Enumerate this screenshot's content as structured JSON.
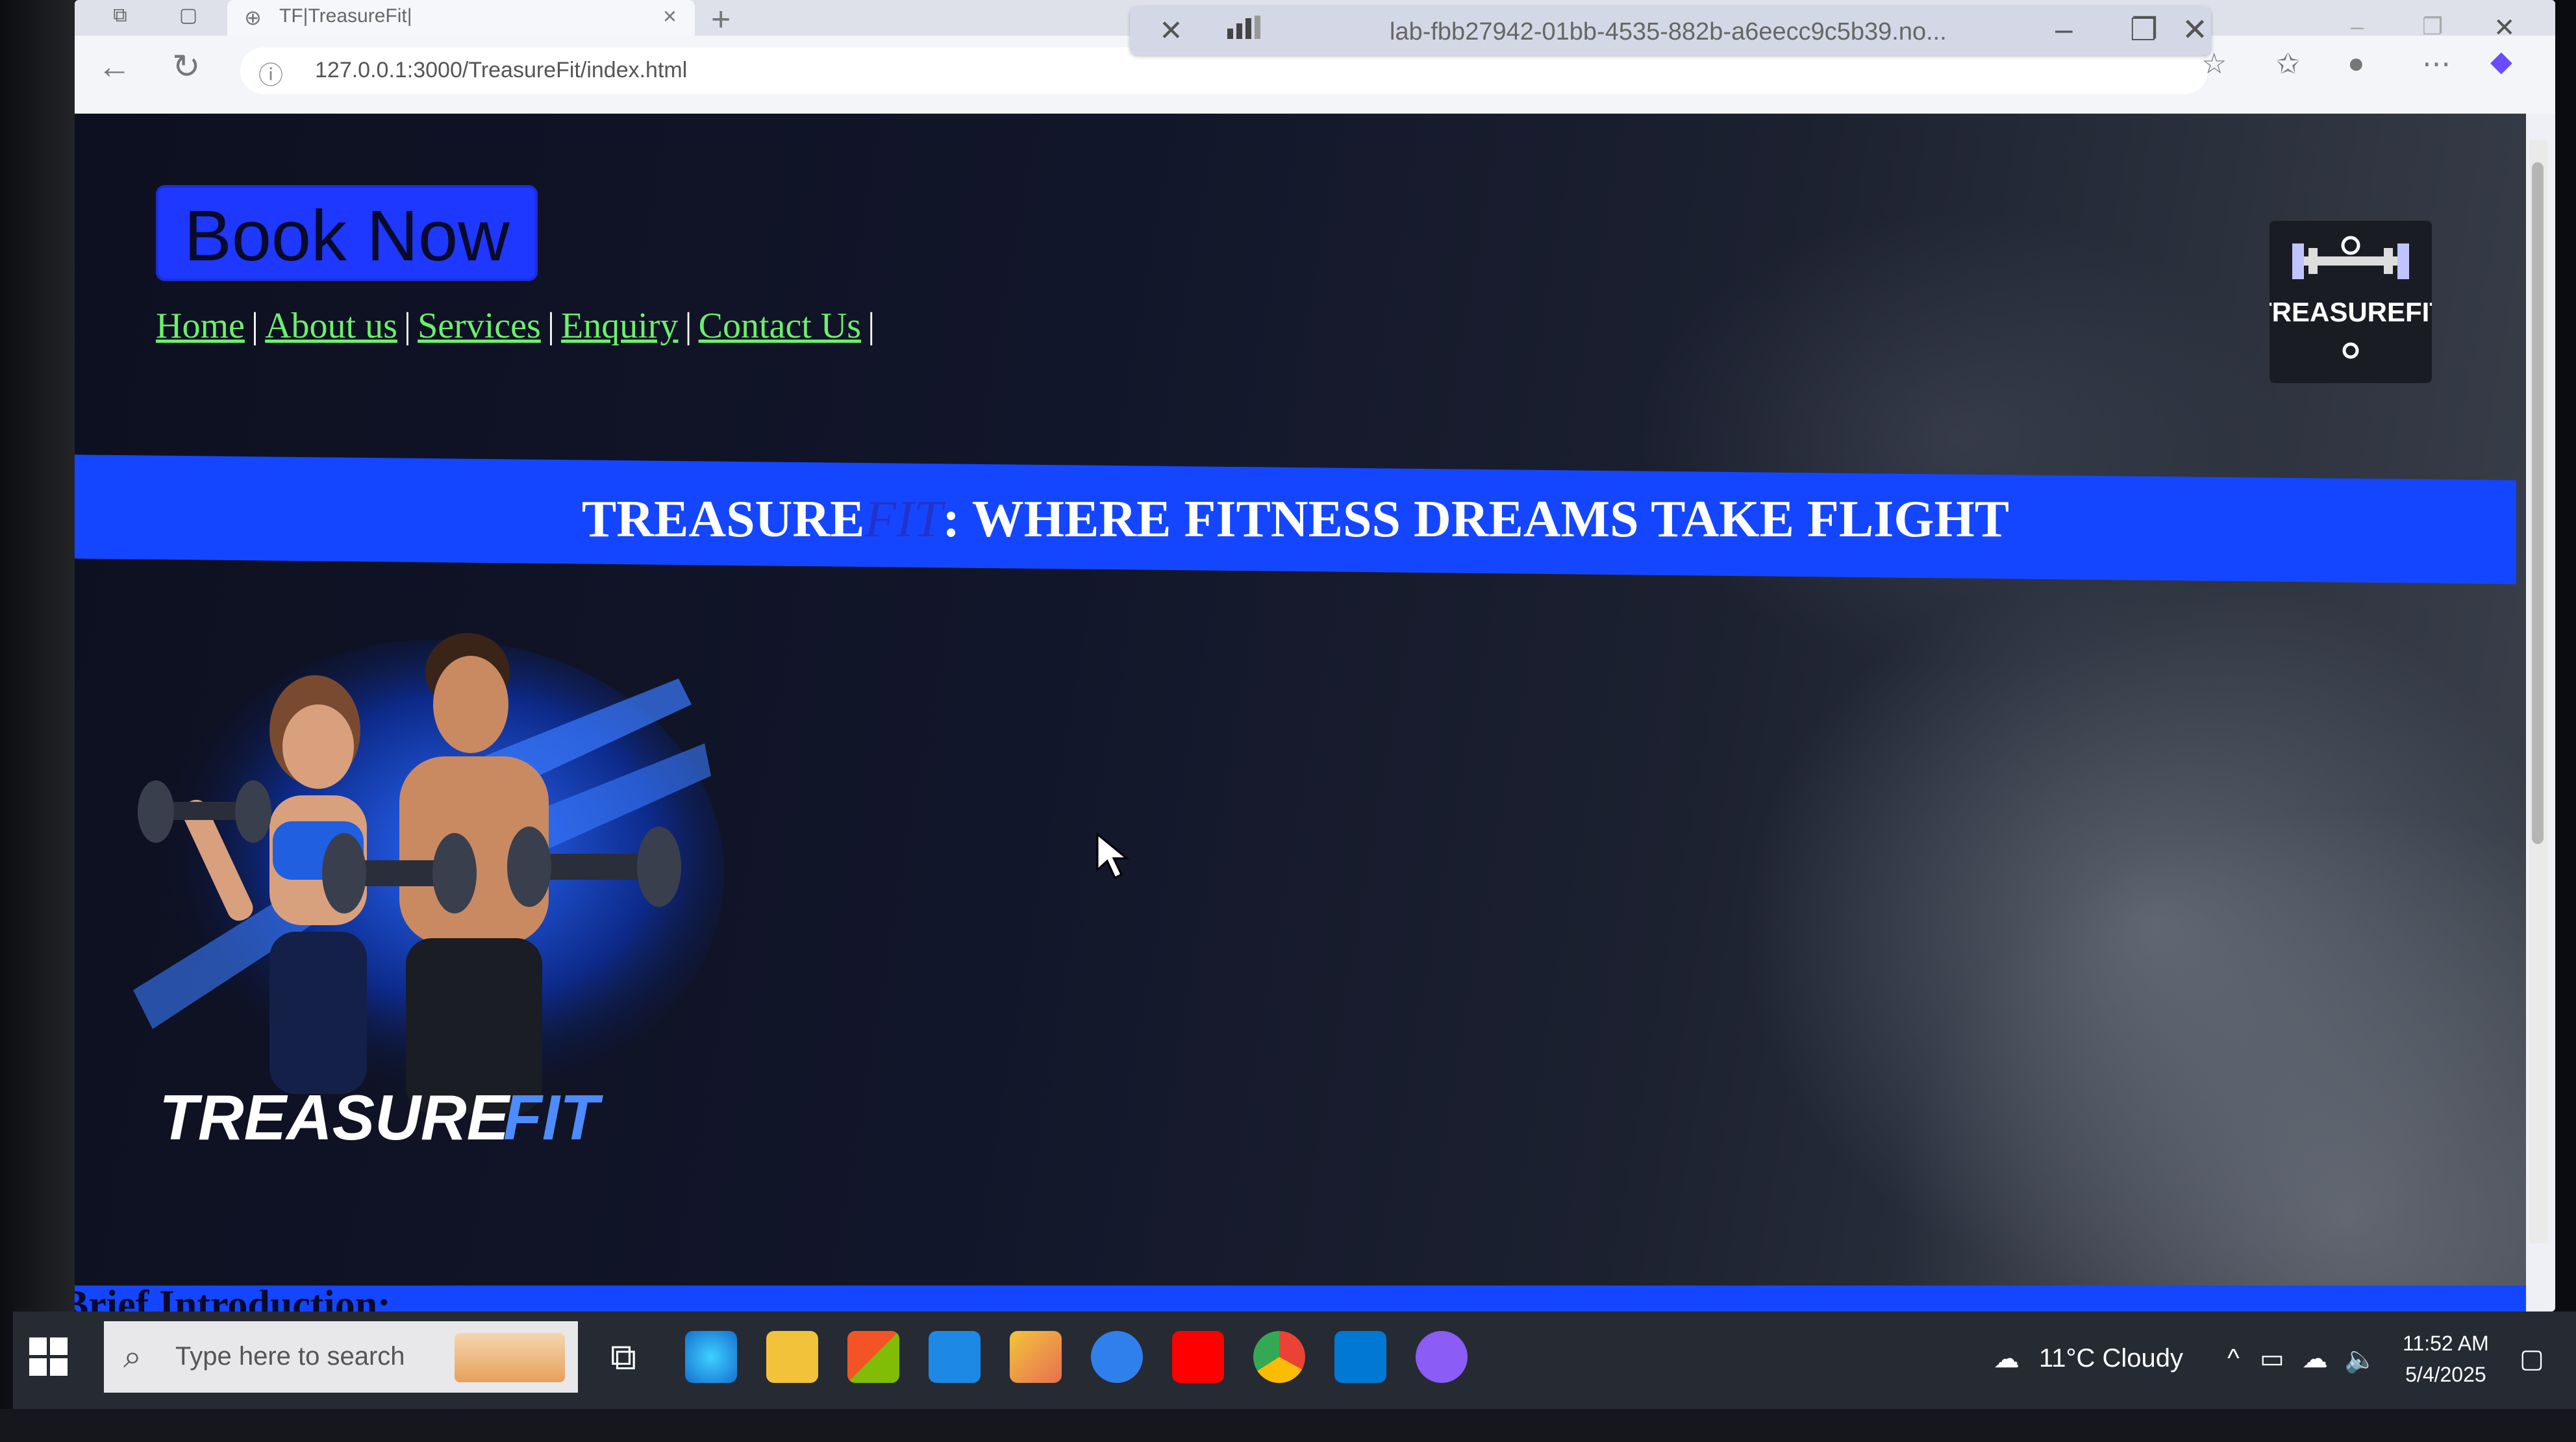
{
  "browser": {
    "tab_title": "TF|TreasureFit|",
    "url": "127.0.0.1:3000/TreasureFit/index.html",
    "session_title": "lab-fbb27942-01bb-4535-882b-a6eecc9c5b39.no..."
  },
  "page": {
    "book_button": "Book Now",
    "nav": [
      "Home",
      "About us",
      "Services",
      "Enquiry",
      "Contact Us"
    ],
    "nav_separator": "|",
    "banner": {
      "part1": "TREASURE",
      "part2": "FIT",
      "part3": ": WHERE FITNESS DREAMS TAKE FLIGHT"
    },
    "logo_text": "TREASUREFIT",
    "hero_brand_1": "TREASURE",
    "hero_brand_2": "FIT",
    "brief_heading": "Brief Introduction:"
  },
  "taskbar": {
    "search_placeholder": "Type here to search",
    "weather": "11°C  Cloudy",
    "time": "11:52 AM",
    "date": "5/4/2025"
  },
  "colors": {
    "accent_blue": "#1546ff",
    "nav_green": "#6cf06c",
    "button_blue": "#1e38ff"
  }
}
